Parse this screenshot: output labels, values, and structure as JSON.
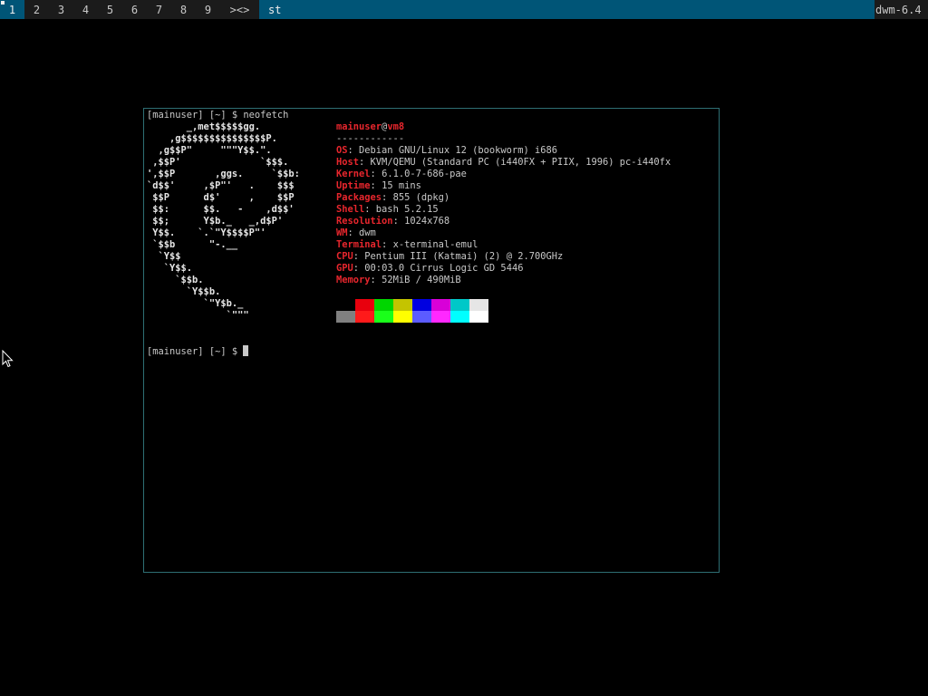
{
  "bar": {
    "tags": [
      "1",
      "2",
      "3",
      "4",
      "5",
      "6",
      "7",
      "8",
      "9"
    ],
    "selected_tag": "1",
    "layout_symbol": "><>",
    "window_title": "st",
    "status_text": "dwm-6.4"
  },
  "terminal": {
    "prompt": "[mainuser] [~] $ ",
    "command": "neofetch",
    "ascii_art": [
      "       _,met$$$$$gg.",
      "    ,g$$$$$$$$$$$$$$$P.",
      "  ,g$$P\"     \"\"\"Y$$.\".",
      " ,$$P'              `$$$.",
      "',$$P       ,ggs.     `$$b:",
      "`d$$'     ,$P\"'   .    $$$",
      " $$P      d$'     ,    $$P",
      " $$:      $$.   -    ,d$$'",
      " $$;      Y$b._   _,d$P'",
      " Y$$.    `.`\"Y$$$$P\"'",
      " `$$b      \"-.__",
      "  `Y$$",
      "   `Y$$.",
      "     `$$b.",
      "       `Y$$b.",
      "          `\"Y$b._",
      "              `\"\"\""
    ],
    "user": "mainuser",
    "at": "@",
    "host": "vm8",
    "separator": "------------",
    "info": [
      {
        "key": "OS",
        "value": "Debian GNU/Linux 12 (bookworm) i686"
      },
      {
        "key": "Host",
        "value": "KVM/QEMU (Standard PC (i440FX + PIIX, 1996) pc-i440fx"
      },
      {
        "key": "Kernel",
        "value": "6.1.0-7-686-pae"
      },
      {
        "key": "Uptime",
        "value": "15 mins"
      },
      {
        "key": "Packages",
        "value": "855 (dpkg)"
      },
      {
        "key": "Shell",
        "value": "bash 5.2.15"
      },
      {
        "key": "Resolution",
        "value": "1024x768"
      },
      {
        "key": "WM",
        "value": "dwm"
      },
      {
        "key": "Terminal",
        "value": "x-terminal-emul"
      },
      {
        "key": "CPU",
        "value": "Pentium III (Katmai) (2) @ 2.700GHz"
      },
      {
        "key": "GPU",
        "value": "00:03.0 Cirrus Logic GD 5446"
      },
      {
        "key": "Memory",
        "value": "52MiB / 490MiB"
      }
    ],
    "colon": ": ",
    "palette_top": [
      "#000000",
      "#e8000d",
      "#00d600",
      "#c4c400",
      "#0000e0",
      "#d800d8",
      "#00c8c8",
      "#e6e6e6"
    ],
    "palette_bottom": [
      "#808080",
      "#ff1a1a",
      "#1aff1a",
      "#ffff00",
      "#5c5cff",
      "#ff28ff",
      "#00ffff",
      "#ffffff"
    ],
    "prompt2": "[mainuser] [~] $ "
  }
}
